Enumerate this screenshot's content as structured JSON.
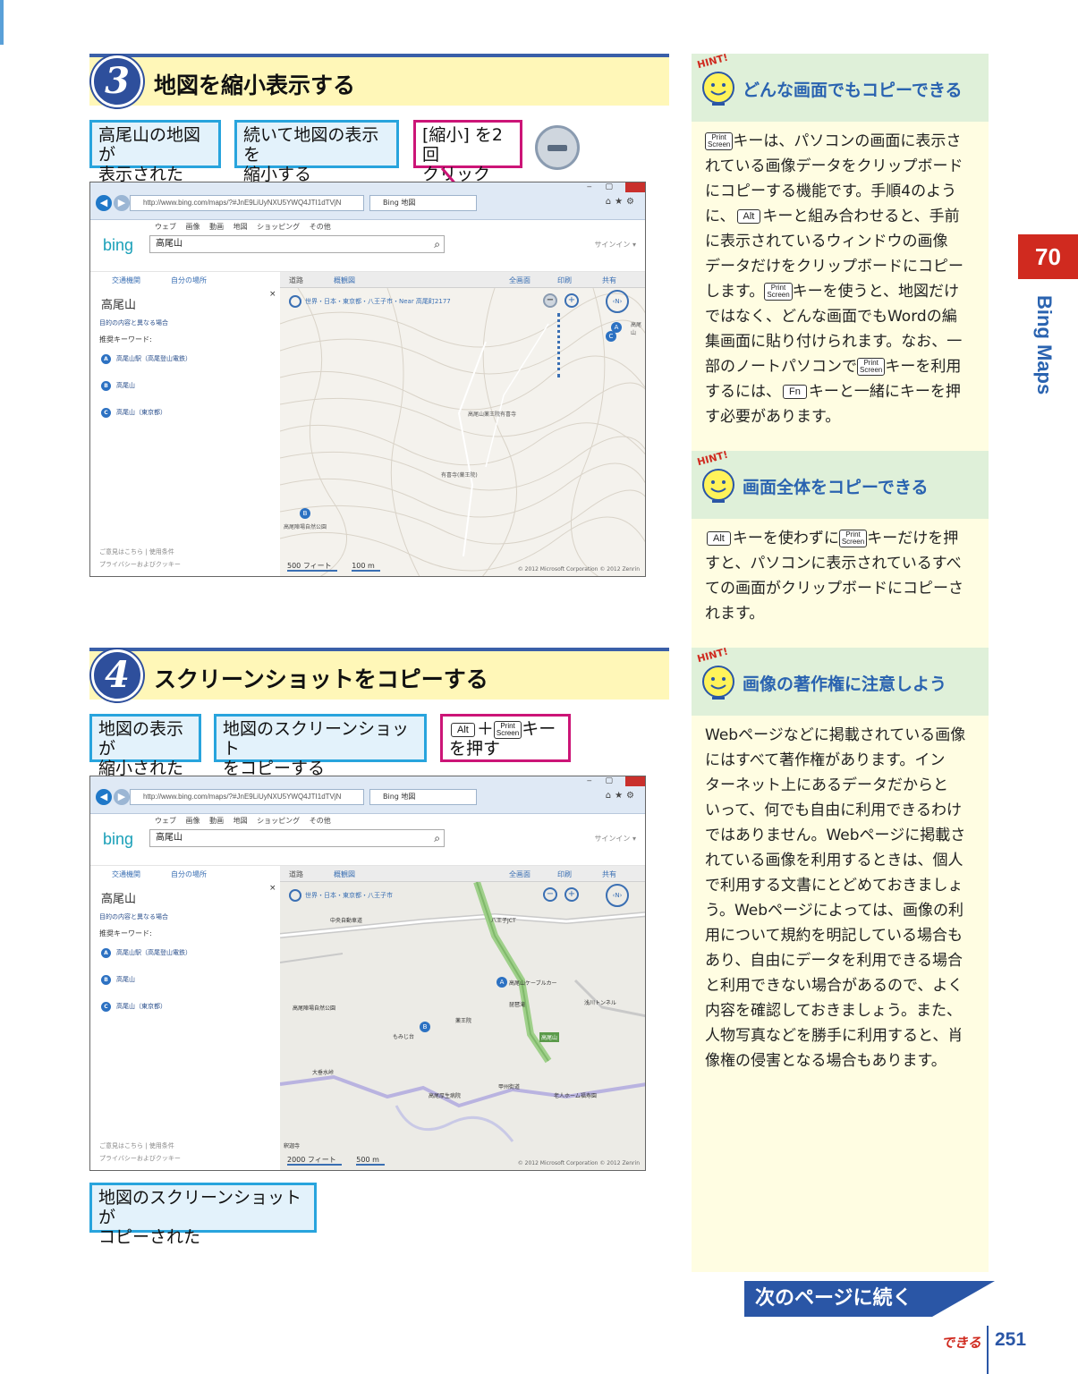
{
  "step3": {
    "number": "3",
    "title": "地図を縮小表示する",
    "callouts": [
      "高尾山の地図が\n表示された",
      "続いて地図の表示を\n縮小する",
      "[縮小] を2回\nクリック"
    ]
  },
  "step4": {
    "number": "4",
    "title": "スクリーンショットをコピーする",
    "callouts": [
      "地図の表示が\n縮小された",
      "地図のスクリーンショット\nをコピーする"
    ],
    "key_callout": {
      "alt": "Alt",
      "plus": "＋",
      "ps_top": "Print",
      "ps_bottom": "Screen",
      "key_text": "キー",
      "line2": "を押す"
    },
    "result_callout": "地図のスクリーンショットが\nコピーされた"
  },
  "browser": {
    "url": "http://www.bing.com/maps/?#JnE9LiUyNXU5YWQ4JTI1dTVjN",
    "tab_title": "Bing 地図",
    "menu": "ウェブ 画像 動画 地図 ショッピング その他",
    "logo": "bing",
    "search_value": "高尾山",
    "signin": "サインイン ▾",
    "traffic": "交通機関",
    "myplaces": "自分の場所",
    "road": "道路",
    "aerial": "概観図",
    "fullscreen": "全画面",
    "print": "印刷",
    "share": "共有",
    "place": "高尾山",
    "different": "目的の内容と異なる場合",
    "keywords": "推奨キーワード:",
    "results": [
      {
        "pin": "A",
        "label": "高尾山駅（高尾登山電鉄）"
      },
      {
        "pin": "B",
        "label": "高尾山"
      },
      {
        "pin": "C",
        "label": "高尾山（東京都）"
      }
    ],
    "feedback": "ご意見はこちら | 使用条件",
    "privacy": "プライバシーおよびクッキー",
    "copyright": "© 2012 Microsoft Corporation  © 2012 Zenrin"
  },
  "shot1": {
    "breadcrumb": "世界・日本・東京都・八王子市・Near 高尾町2177",
    "scale_a": "500 フィート",
    "scale_b": "100 m",
    "labels": [
      "高尾山",
      "高尾山薬王院有喜寺",
      "有喜寺(薬王院)",
      "高尾陣場自然公園",
      "高尾山"
    ]
  },
  "shot2": {
    "breadcrumb": "世界・日本・東京都・八王子市",
    "scale_a": "2000 フィート",
    "scale_b": "500 m",
    "labels": [
      "中央自動車道",
      "八王子JCT",
      "浅川トンネル",
      "高尾山",
      "高尾山ケーブルカー",
      "琵琶滝",
      "薬王院",
      "もみじ台",
      "大垂水峠",
      "甲州街道",
      "高尾陣場自然公園",
      "釈迦寺",
      "高尾厚生病院",
      "老人ホーム福寿園"
    ]
  },
  "hints": [
    {
      "label": "HINT!",
      "title": "どんな画面でもコピーできる",
      "body": [
        {
          "ps": true,
          "text": "キーは、パソコンの画面に表示さ"
        },
        {
          "text": "れている画像データをクリップボード"
        },
        {
          "text": "にコピーする機能です。手順4のよう"
        },
        {
          "pre": "に、",
          "alt": "Alt",
          "text": "キーと組み合わせると、手前"
        },
        {
          "text": "に表示されているウィンドウの画像"
        },
        {
          "text": "データだけをクリップボードにコピー"
        },
        {
          "pre": "します。",
          "ps": true,
          "text": "キーを使うと、地図だけ"
        },
        {
          "text": "ではなく、どんな画面でもWordの編"
        },
        {
          "text": "集画面に貼り付けられます。なお、一"
        },
        {
          "pre": "部のノートパソコンで",
          "ps": true,
          "text": "キーを利用"
        },
        {
          "pre": "するには、",
          "alt": "Fn",
          "text": "キーと一緒にキーを押"
        },
        {
          "text": "す必要があります。"
        }
      ]
    },
    {
      "label": "HINT!",
      "title": "画面全体をコピーできる",
      "body": [
        {
          "alt": "Alt",
          "text": "キーを使わずに",
          "ps2": true,
          "post": "キーだけを押"
        },
        {
          "text": "すと、パソコンに表示されているすべ"
        },
        {
          "text": "ての画面がクリップボードにコピーさ"
        },
        {
          "text": "れます。"
        }
      ]
    },
    {
      "label": "HINT!",
      "title": "画像の著作権に注意しよう",
      "body": [
        {
          "text": "Webページなどに掲載されている画像"
        },
        {
          "text": "にはすべて著作権があります。イン"
        },
        {
          "text": "ターネット上にあるデータだからと"
        },
        {
          "text": "いって、何でも自由に利用できるわけ"
        },
        {
          "text": "ではありません。Webページに掲載さ"
        },
        {
          "text": "れている画像を利用するときは、個人"
        },
        {
          "text": "で利用する文書にとどめておきましょ"
        },
        {
          "text": "う。Webページによっては、画像の利"
        },
        {
          "text": "用について規約を明記している場合も"
        },
        {
          "text": "あり、自由にデータを利用できる場合"
        },
        {
          "text": "と利用できない場合があるので、よく"
        },
        {
          "text": "内容を確認しておきましょう。また、"
        },
        {
          "text": "人物写真などを勝手に利用すると、肖"
        },
        {
          "text": "像権の侵害となる場合もあります。"
        }
      ]
    }
  ],
  "section_number": "70",
  "section_title": "Bing Maps",
  "continue_label": "次のページに続く",
  "footer": {
    "brand": "できる",
    "page": "251"
  },
  "colors": {
    "accent_blue": "#2a56a6",
    "callout_blue": "#28a4dd",
    "callout_pink": "#cc1577",
    "section_red": "#d02a1f"
  }
}
